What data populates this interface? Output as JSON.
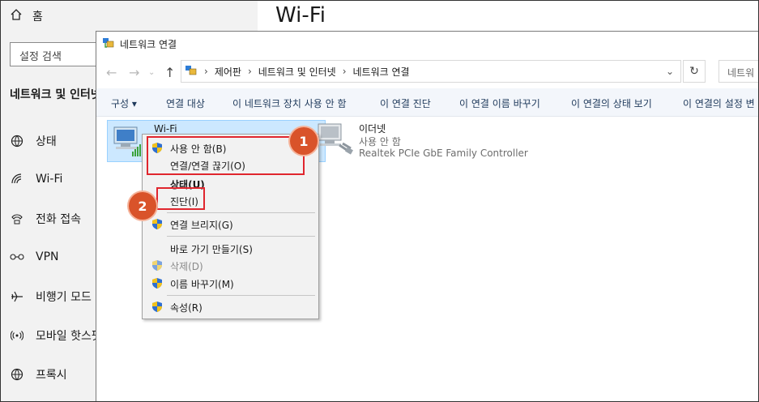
{
  "settings": {
    "home_label": "홈",
    "search_placeholder": "설정 검색",
    "section_title": "네트워크 및 인터넷",
    "nav": [
      {
        "label": "상태",
        "icon": "globe-icon"
      },
      {
        "label": "Wi-Fi",
        "icon": "wifi-icon"
      },
      {
        "label": "전화 접속",
        "icon": "phone-icon"
      },
      {
        "label": "VPN",
        "icon": "vpn-icon"
      },
      {
        "label": "비행기 모드",
        "icon": "airplane-icon"
      },
      {
        "label": "모바일 핫스팟",
        "icon": "hotspot-icon"
      },
      {
        "label": "프록시",
        "icon": "globe-icon"
      }
    ],
    "page_title": "Wi-Fi"
  },
  "window": {
    "title": "네트워크 연결",
    "breadcrumb": [
      "제어판",
      "네트워크 및 인터넷",
      "네트워크 연결"
    ],
    "search_placeholder": "네트워",
    "commands": [
      "구성 ▾",
      "연결 대상",
      "이 네트워크 장치 사용 안 함",
      "이 연결 진단",
      "이 연결 이름 바꾸기",
      "이 연결의 상태 보기",
      "이 연결의 설정 변"
    ]
  },
  "adapters": [
    {
      "name": "Wi-Fi",
      "status": "",
      "device": ""
    },
    {
      "name": "이더넷",
      "status": "사용 안 함",
      "device": "Realtek PCIe GbE Family Controller"
    }
  ],
  "context_menu": {
    "items": [
      {
        "label": "사용 안 함(B)",
        "shield": true,
        "style": "normal"
      },
      {
        "label": "연결/연결 끊기(O)",
        "shield": false,
        "style": "normal"
      },
      {
        "label": "상태(U)",
        "shield": false,
        "style": "bold"
      },
      {
        "label": "진단(I)",
        "shield": false,
        "style": "normal"
      },
      {
        "label": "연결 브리지(G)",
        "shield": true,
        "style": "normal"
      },
      {
        "label": "바로 가기 만들기(S)",
        "shield": false,
        "style": "normal"
      },
      {
        "label": "삭제(D)",
        "shield": true,
        "style": "disabled"
      },
      {
        "label": "이름 바꾸기(M)",
        "shield": true,
        "style": "normal"
      },
      {
        "label": "속성(R)",
        "shield": true,
        "style": "normal"
      }
    ]
  },
  "annotations": {
    "badge1": "1",
    "badge2": "2",
    "highlight_color": "#e0262e",
    "badge_color": "#d9532a"
  }
}
